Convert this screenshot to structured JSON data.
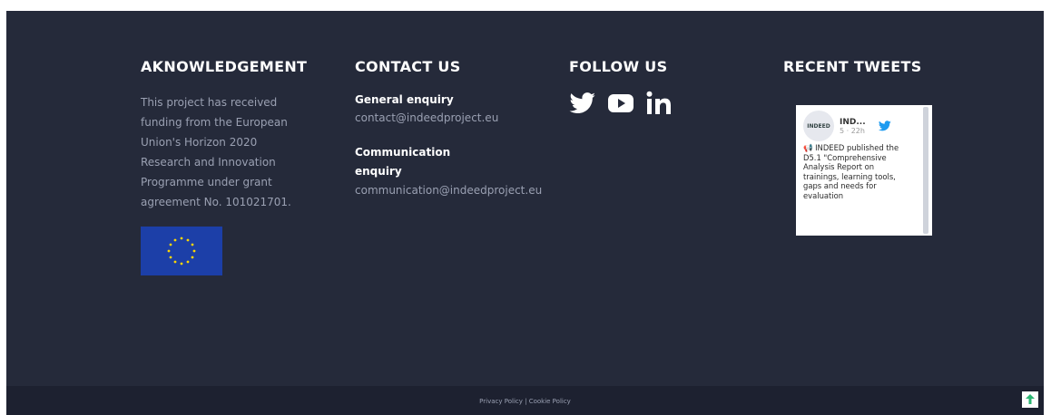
{
  "acknowledgement": {
    "title": "AKNOWLEDGEMENT",
    "text": "This project has received funding from the European Union's Horizon 2020 Research and Innovation Programme under grant agreement No. 101021701."
  },
  "contact": {
    "title": "CONTACT US",
    "general_label": "General enquiry",
    "general_email": "contact@indeedproject.eu",
    "communication_label": "Communication enquiry",
    "communication_email": "communication@indeedproject.eu"
  },
  "follow": {
    "title": "FOLLOW US",
    "icons": [
      "twitter-icon",
      "youtube-icon",
      "linkedin-icon"
    ]
  },
  "tweets": {
    "title": "RECENT TWEETS",
    "author": "IND...",
    "meta": "5 · 22h",
    "avatar_text": "INDEED",
    "text": "📢 INDEED published the D5.1 \"Comprehensive Analysis Report on trainings, learning tools, gaps and needs for evaluation"
  },
  "bottom": {
    "privacy": "Privacy Policy",
    "separator": " | ",
    "cookie": "Cookie Policy"
  },
  "colors": {
    "footer_bg": "#252a3a",
    "bottom_bg": "#1d2130",
    "eu_blue": "#1c3fa8",
    "twitter_blue": "#1d9bf0",
    "back_to_top": "#2bb673"
  }
}
